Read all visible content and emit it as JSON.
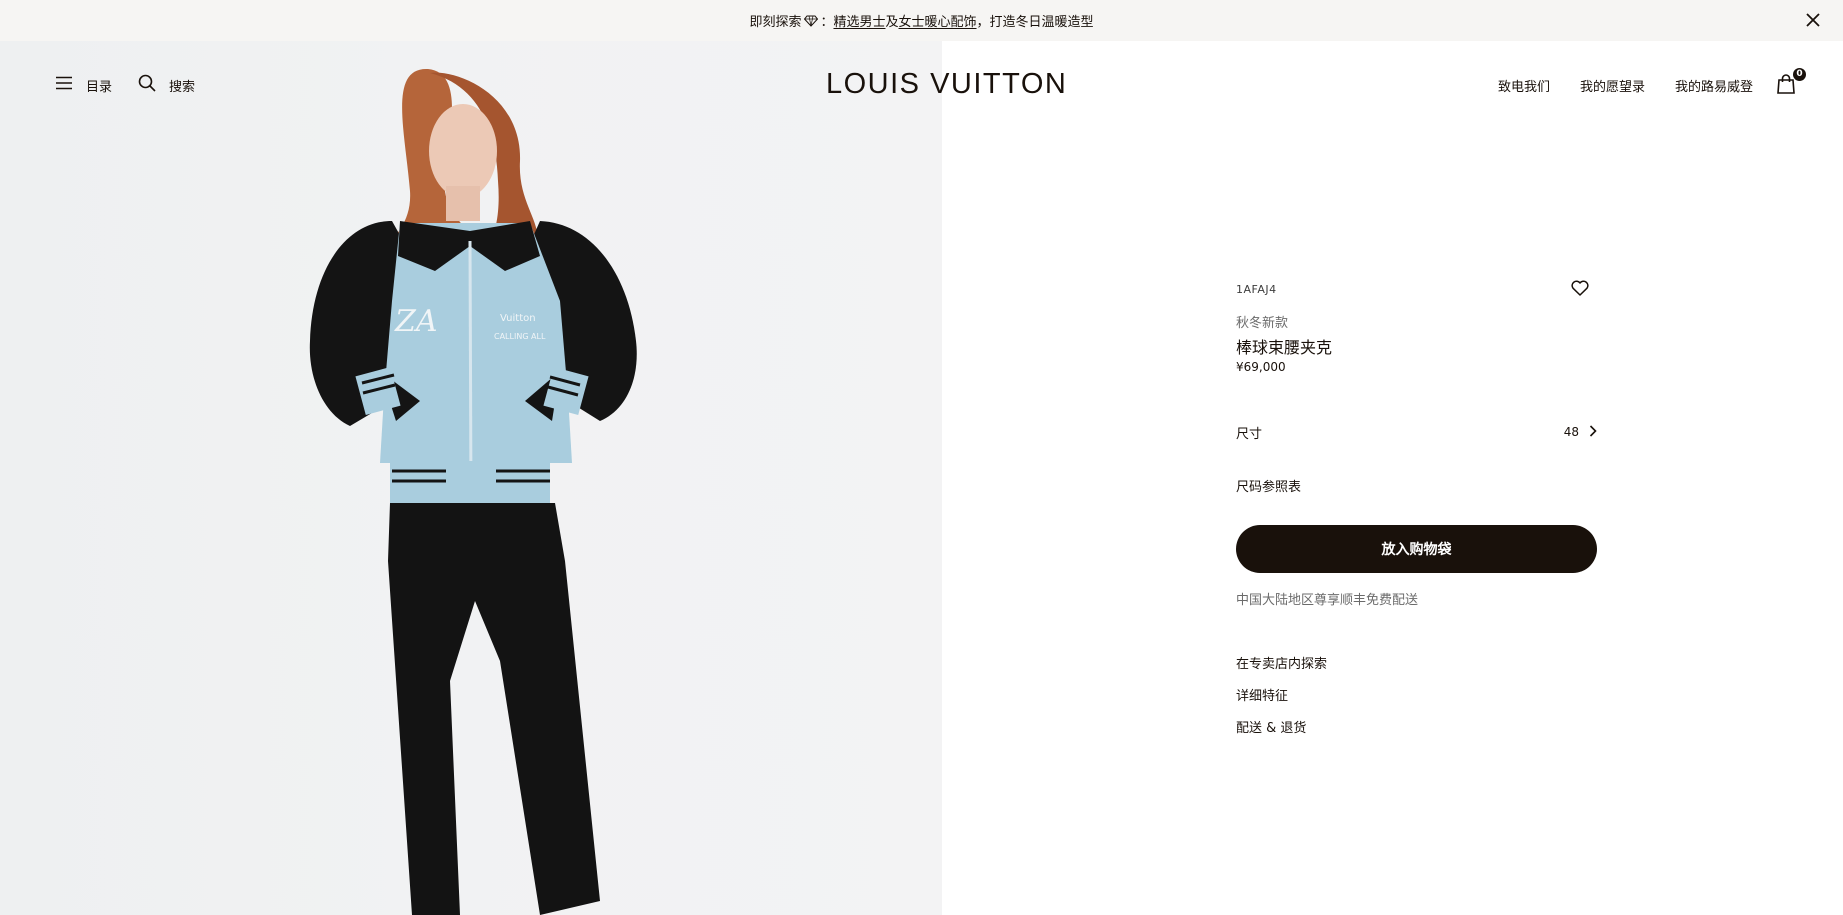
{
  "announcement": {
    "prefix": "即刻探索",
    "separator": "：",
    "link_men": "精选男士",
    "joiner": "及",
    "link_women": "女士暖心配饰",
    "suffix": "，打造冬日温暖造型",
    "gem_icon": "gem-icon",
    "close_icon": "close-icon"
  },
  "header": {
    "menu_label": "目录",
    "search_label": "搜索",
    "logo": "LOUIS VUITTON",
    "contact_label": "致电我们",
    "wishlist_label": "我的愿望录",
    "account_label": "我的路易威登",
    "bag_count": "0",
    "icons": {
      "menu": "hamburger-icon",
      "search": "search-icon",
      "bag": "shopping-bag-icon"
    }
  },
  "product": {
    "sku": "1AFAJ4",
    "tagline": "秋冬新款",
    "name": "棒球束腰夹克",
    "price": "¥69,000",
    "size_label": "尺寸",
    "size_value": "48",
    "size_guide": "尺码参照表",
    "add_to_bag": "放入购物袋",
    "shipping_note": "中国大陆地区尊享顺丰免费配送",
    "links": [
      "在专卖店内探索",
      "详细特征",
      "配送 & 退货"
    ],
    "icons": {
      "wishlist": "heart-icon",
      "size_chevron": "chevron-right-icon"
    }
  },
  "colors": {
    "ink": "#19110b",
    "announcement_bg": "#f6f5f3",
    "muted_text": "#6b6b6b",
    "jacket_body": "#a9cdde",
    "jacket_sleeves": "#141414"
  }
}
